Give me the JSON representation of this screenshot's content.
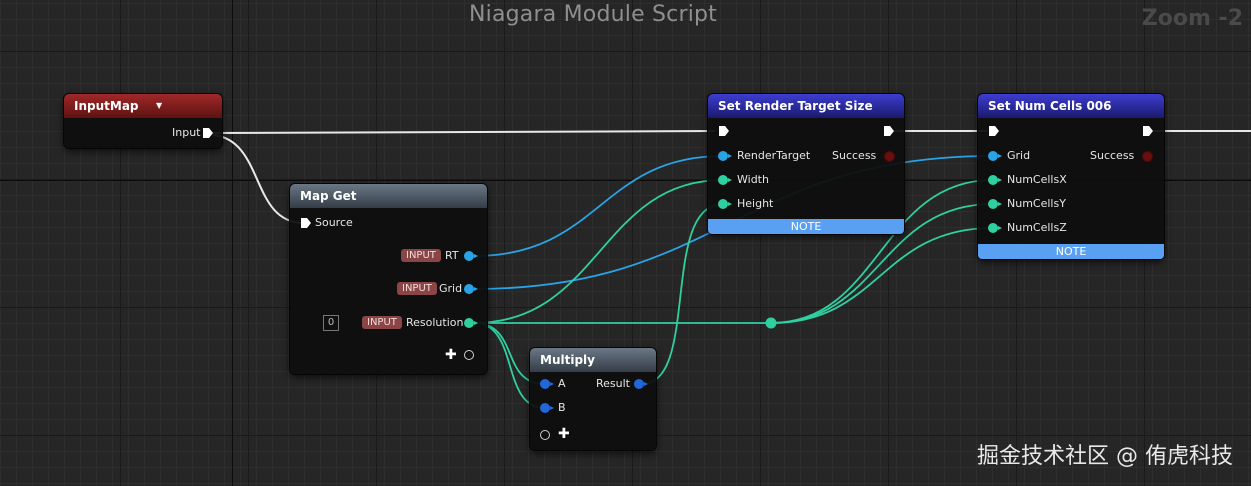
{
  "graph": {
    "title": "Niagara Module Script",
    "zoom": "Zoom -2"
  },
  "input_map": {
    "title": "InputMap",
    "output_label": "Input"
  },
  "map_get": {
    "title": "Map Get",
    "source_label": "Source",
    "rows": [
      {
        "badge": "INPUT",
        "label": "RT"
      },
      {
        "badge": "INPUT",
        "label": "Grid"
      },
      {
        "badge": "INPUT",
        "label": "Resolution",
        "index": "0"
      }
    ]
  },
  "set_rt_size": {
    "title": "Set Render Target Size",
    "inputs": [
      "RenderTarget",
      "Width",
      "Height"
    ],
    "output": "Success",
    "note": "NOTE"
  },
  "set_num_cells": {
    "title": "Set Num Cells 006",
    "inputs": [
      "Grid",
      "NumCellsX",
      "NumCellsY",
      "NumCellsZ"
    ],
    "output": "Success",
    "note": "NOTE"
  },
  "multiply": {
    "title": "Multiply",
    "inputs": [
      "A",
      "B"
    ],
    "output": "Result"
  },
  "watermark": "掘金技术社区 @ 侑虎科技",
  "colors": {
    "exec": "#ffffff",
    "float": "#2fd0a0",
    "object": "#29a3e6",
    "int": "#2266d8",
    "input_badge": "#8a4646",
    "note": "#5aa0f2"
  }
}
